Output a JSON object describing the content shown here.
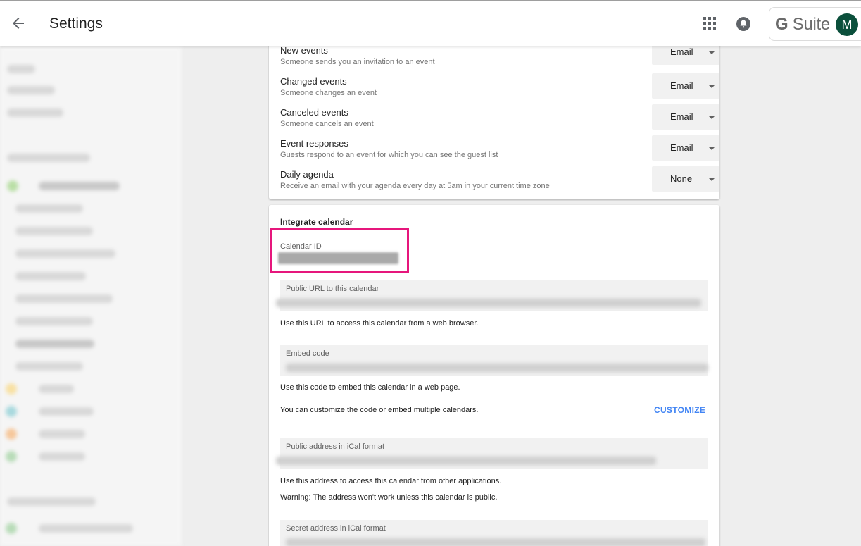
{
  "header": {
    "title": "Settings",
    "back_icon": "arrow-back-icon",
    "apps_icon": "apps-grid-icon",
    "notifications_icon": "bell-icon",
    "brand_g": "G",
    "brand_suite": "Suite",
    "avatar_initial": "M",
    "avatar_color": "#0b4f3b"
  },
  "notifications": [
    {
      "title": "New events",
      "subtitle": "Someone sends you an invitation to an event",
      "value": "Email"
    },
    {
      "title": "Changed events",
      "subtitle": "Someone changes an event",
      "value": "Email"
    },
    {
      "title": "Canceled events",
      "subtitle": "Someone cancels an event",
      "value": "Email"
    },
    {
      "title": "Event responses",
      "subtitle": "Guests respond to an event for which you can see the guest list",
      "value": "Email"
    },
    {
      "title": "Daily agenda",
      "subtitle": "Receive an email with your agenda every day at 5am in your current time zone",
      "value": "None"
    }
  ],
  "integrate": {
    "title": "Integrate calendar",
    "calendar_id_label": "Calendar ID",
    "public_url_label": "Public URL to this calendar",
    "public_url_help": "Use this URL to access this calendar from a web browser.",
    "embed_label": "Embed code",
    "embed_help": "Use this code to embed this calendar in a web page.",
    "customize_help": "You can customize the code or embed multiple calendars.",
    "customize_button": "CUSTOMIZE",
    "ical_public_label": "Public address in iCal format",
    "ical_public_help": "Use this address to access this calendar from other applications.",
    "ical_public_warning": "Warning: The address won't work unless this calendar is public.",
    "ical_secret_label": "Secret address in iCal format"
  },
  "colors": {
    "highlight": "#e6167c",
    "accent": "#4285f4"
  }
}
